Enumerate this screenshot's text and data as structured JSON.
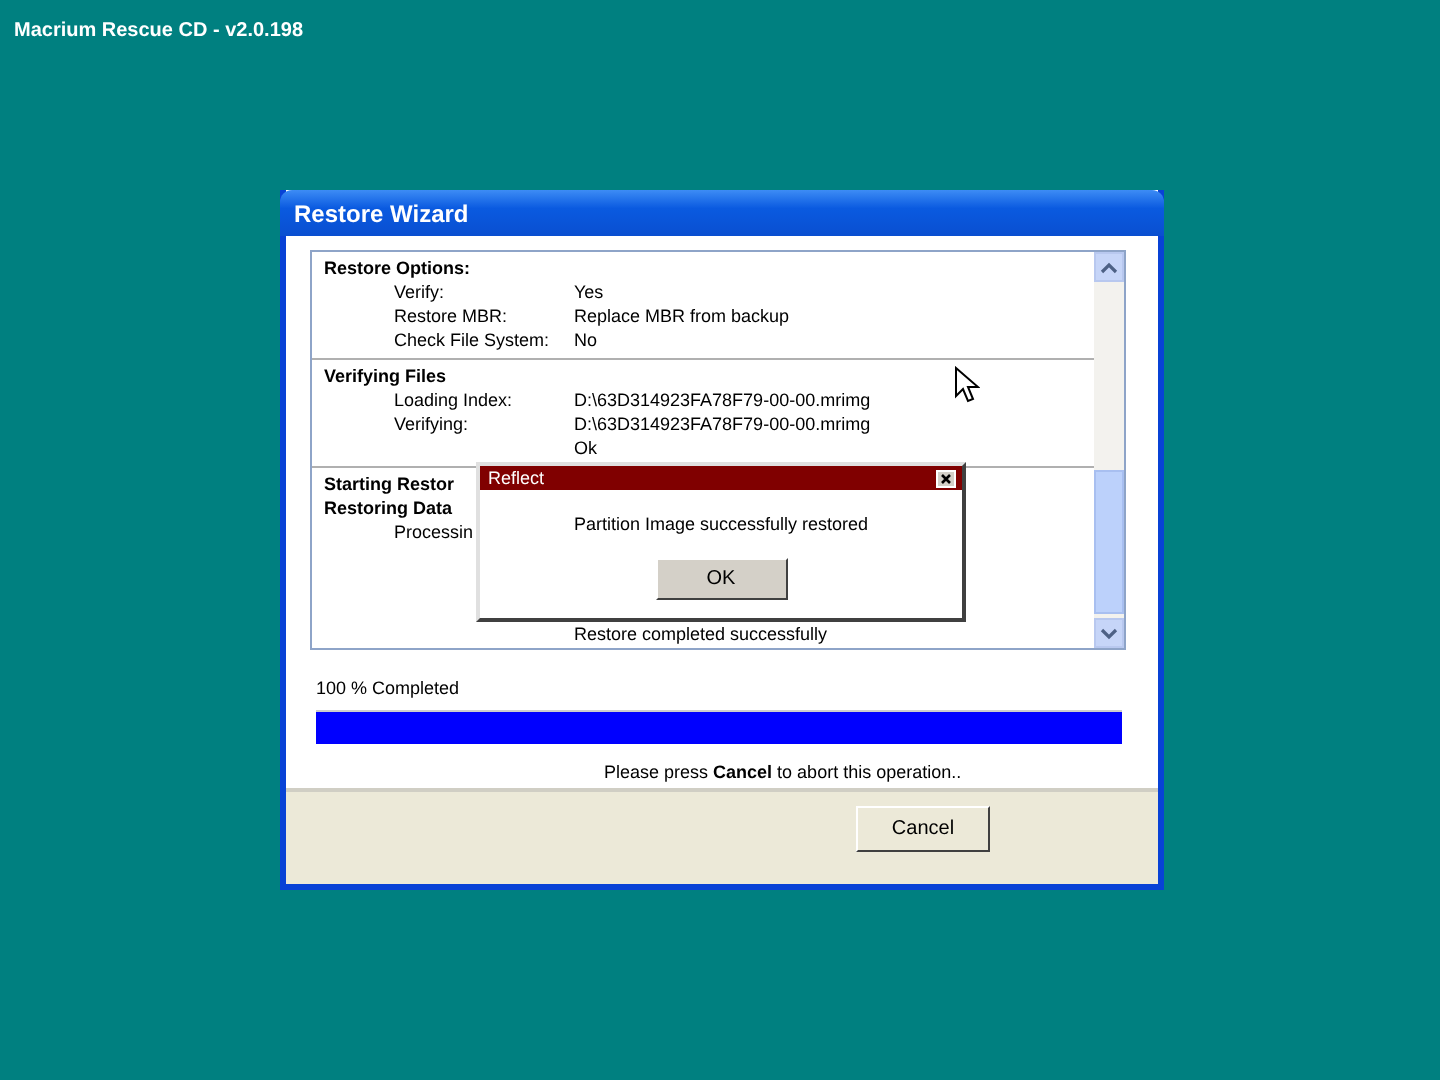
{
  "desktop_title": "Macrium Rescue CD - v2.0.198",
  "window": {
    "title": "Restore Wizard"
  },
  "log": [
    {
      "headings": [
        "Restore Options:"
      ],
      "rows": [
        {
          "label": "Verify:",
          "value": "Yes"
        },
        {
          "label": "Restore MBR:",
          "value": "Replace MBR from backup"
        },
        {
          "label": "Check File System:",
          "value": "No"
        }
      ]
    },
    {
      "headings": [
        "Verifying Files"
      ],
      "rows": [
        {
          "label": "Loading Index:",
          "value": "D:\\63D314923FA78F79-00-00.mrimg"
        },
        {
          "label": "Verifying:",
          "value": "D:\\63D314923FA78F79-00-00.mrimg"
        },
        {
          "value": "Ok"
        }
      ]
    },
    {
      "headings": [
        "Starting Restor",
        "Restoring Data"
      ],
      "rows": [
        {
          "label": "Processin"
        },
        {
          "value": "Restore completed successfully"
        }
      ]
    }
  ],
  "progress": {
    "label": "100 % Completed",
    "level": 1
  },
  "hint": "Please press **Cancel** to abort this operation..",
  "buttons": [
    "Cancel"
  ],
  "dialog": {
    "title": "Reflect",
    "message": "Partition Image successfully restored",
    "button": "OK"
  }
}
